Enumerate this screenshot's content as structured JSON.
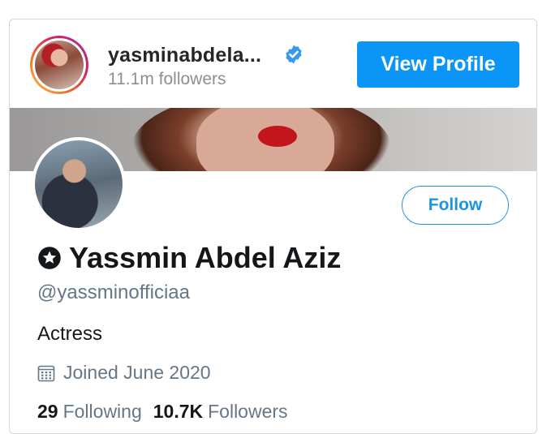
{
  "instagram": {
    "username": "yasminabdela...",
    "followers": "11.1m followers",
    "view_profile_label": "View Profile"
  },
  "twitter": {
    "follow_label": "Follow",
    "display_name": "Yassmin Abdel Aziz",
    "handle": "@yassminofficiaa",
    "bio": "Actress",
    "joined": "Joined June 2020",
    "following_count": "29",
    "following_label": "Following",
    "followers_count": "10.7K",
    "followers_label": "Followers"
  },
  "colors": {
    "instagram_button": "#0b95f6",
    "twitter_blue": "#1b95e0",
    "verified_blue": "#3897f0"
  },
  "icons": [
    "verified-badge-icon",
    "star-badge-icon",
    "calendar-icon"
  ]
}
